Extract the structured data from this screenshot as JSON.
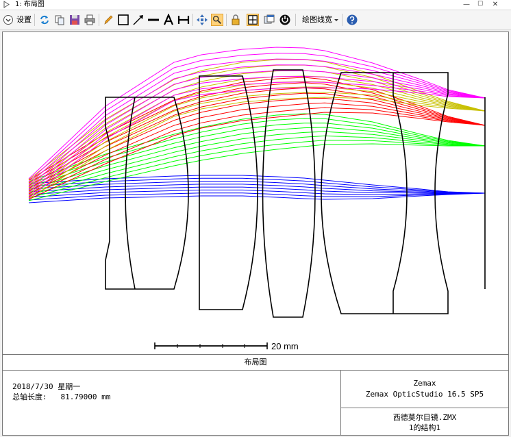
{
  "window": {
    "title": "1: 布局图"
  },
  "toolbar": {
    "settings_label": "设置",
    "line_width_label": "绘图线宽"
  },
  "scale_bar": {
    "label": "20 mm"
  },
  "caption": "布局图",
  "info": {
    "date_line": "2018/7/30 星期一",
    "axis_length_line": "总轴长度:   81.79000 mm",
    "company": "Zemax",
    "product": "Zemax OpticStudio 16.5 SP5",
    "file_name": "西德莫尔目镜.ZMX",
    "configuration": "1的结构1"
  },
  "colors": {
    "field1": "#0000ff",
    "field2": "#00ff00",
    "field3": "#ff0000",
    "field4": "#c8c000",
    "field5": "#ff00ff",
    "lens_outline": "#000000"
  },
  "icons": [
    "layout-icon",
    "minimize-icon",
    "maximize-icon",
    "close-icon",
    "settings-dropdown-icon",
    "refresh-icon",
    "copy-icon",
    "save-icon",
    "print-icon",
    "pencil-icon",
    "rectangle-icon",
    "arrow-icon",
    "line-icon",
    "text-icon",
    "dimension-icon",
    "pan-icon",
    "zoom-icon",
    "lock-icon",
    "fit-icon",
    "clone-icon",
    "rotate-icon",
    "dropdown-icon",
    "help-icon"
  ]
}
